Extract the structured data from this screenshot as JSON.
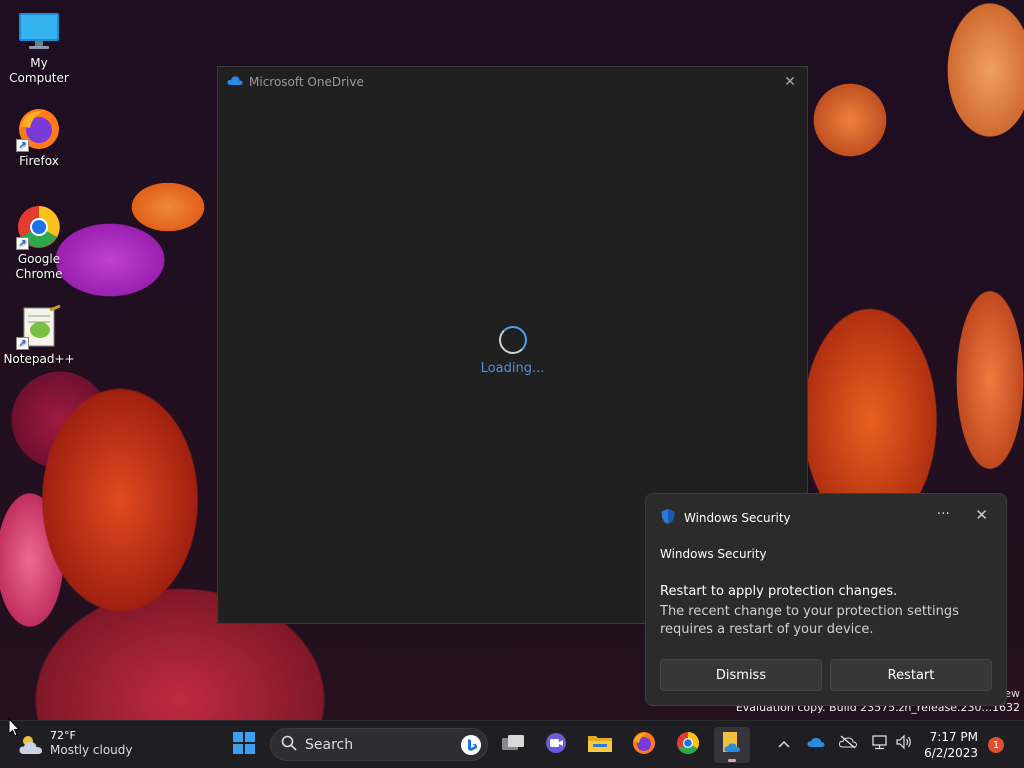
{
  "desktop": {
    "icons": [
      {
        "label": "My Computer"
      },
      {
        "label": "Firefox"
      },
      {
        "label": "Google Chrome"
      },
      {
        "label": "Notepad++"
      }
    ]
  },
  "onedrive": {
    "title": "Microsoft OneDrive",
    "loading_text": "Loading..."
  },
  "toast": {
    "header": "Windows Security",
    "app_name": "Windows Security",
    "title": "Restart to apply protection changes.",
    "body": "The recent change to your protection settings requires a restart of your device.",
    "more": "···",
    "close": "✕",
    "dismiss_label": "Dismiss",
    "restart_label": "Restart"
  },
  "watermark": {
    "line1": "ew",
    "line2": "Evaluation copy. Build 23575.zn_release.230...1632"
  },
  "taskbar": {
    "weather_temp": "72°F",
    "weather_cond": "Mostly cloudy",
    "search_label": "Search",
    "time": "7:17 PM",
    "date": "6/2/2023",
    "notification_count": "1"
  }
}
